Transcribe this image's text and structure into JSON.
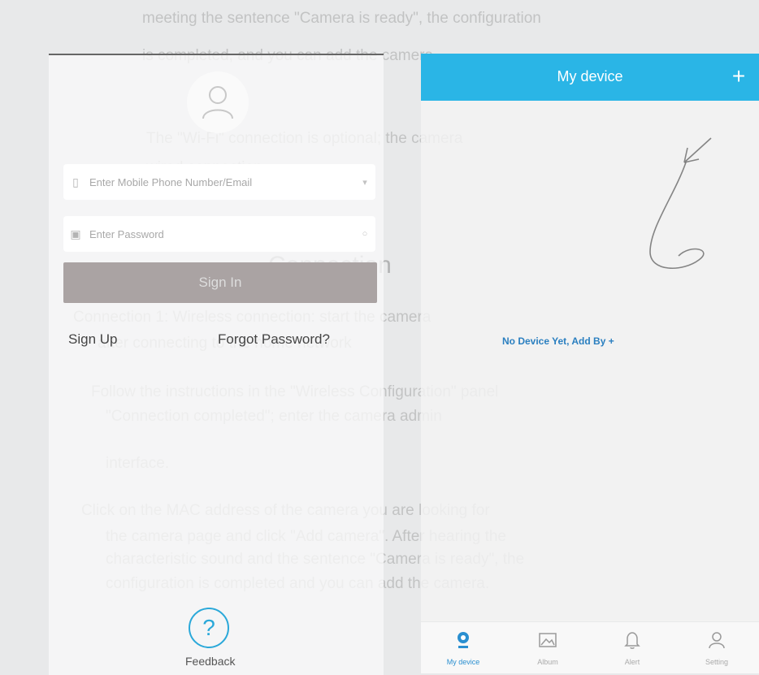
{
  "login": {
    "phone_placeholder": "Enter Mobile Phone Number/Email",
    "password_placeholder": "Enter Password",
    "signin_label": "Sign In",
    "signup_label": "Sign Up",
    "forgot_label": "Forgot Password?",
    "feedback_symbol": "?",
    "feedback_label": "Feedback"
  },
  "device": {
    "title": "My device",
    "add_symbol": "+",
    "empty_hint": "No Device Yet, Add By +"
  },
  "tabs": [
    {
      "label": "My device",
      "icon": "location-pin-icon",
      "active": true
    },
    {
      "label": "Album",
      "icon": "picture-icon",
      "active": false
    },
    {
      "label": "Alert",
      "icon": "bell-icon",
      "active": false
    },
    {
      "label": "Setting",
      "icon": "person-icon",
      "active": false
    }
  ],
  "background_text": [
    "meeting the sentence \"Camera is ready\", the configuration",
    "is completed, and you can add the camera.",
    "The \"Wi-Fi\" connection is optional; the camera",
    "wired connection",
    "Connection",
    "Connection 1: Wireless connection: start the camera",
    "after connecting to the home network",
    "Follow the instructions in the \"Wireless Configuration\" panel",
    "\"Connection completed\"; enter the camera admin",
    "interface.",
    "Click on the MAC address of the camera you are looking for",
    "the camera page and click \"Add camera\". After hearing the",
    "characteristic sound and the sentence \"Camera is ready\", the",
    "configuration is completed and you can add the camera."
  ],
  "colors": {
    "accent": "#2ab5e6",
    "signin_button": "#aaa3a3",
    "link_blue": "#2a7fc0"
  }
}
